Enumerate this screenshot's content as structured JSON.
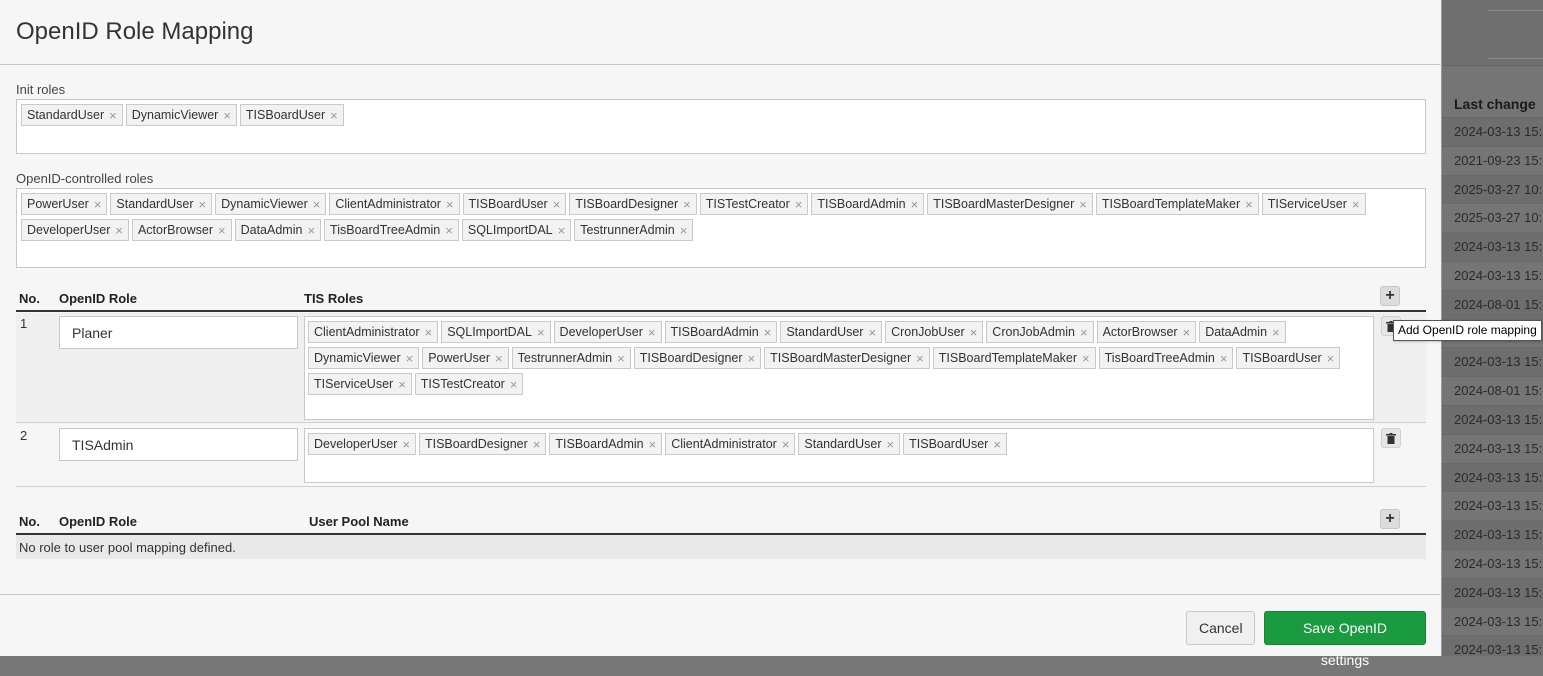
{
  "modal": {
    "title": "OpenID Role Mapping",
    "init_roles_label": "Init roles",
    "init_roles": [
      "StandardUser",
      "DynamicViewer",
      "TISBoardUser"
    ],
    "controlled_roles_label": "OpenID-controlled roles",
    "controlled_roles": [
      "PowerUser",
      "StandardUser",
      "DynamicViewer",
      "ClientAdministrator",
      "TISBoardUser",
      "TISBoardDesigner",
      "TISTestCreator",
      "TISBoardAdmin",
      "TISBoardMasterDesigner",
      "TISBoardTemplateMaker",
      "TIServiceUser",
      "DeveloperUser",
      "ActorBrowser",
      "DataAdmin",
      "TisBoardTreeAdmin",
      "SQLImportDAL",
      "TestrunnerAdmin"
    ],
    "role_table": {
      "col_no": "No.",
      "col_openid_role": "OpenID Role",
      "col_tis_roles": "TIS Roles",
      "rows": [
        {
          "no": "1",
          "openid_role": "Planer",
          "tis_roles": [
            "ClientAdministrator",
            "SQLImportDAL",
            "DeveloperUser",
            "TISBoardAdmin",
            "StandardUser",
            "CronJobUser",
            "CronJobAdmin",
            "ActorBrowser",
            "DataAdmin",
            "DynamicViewer",
            "PowerUser",
            "TestrunnerAdmin",
            "TISBoardDesigner",
            "TISBoardMasterDesigner",
            "TISBoardTemplateMaker",
            "TisBoardTreeAdmin",
            "TISBoardUser",
            "TIServiceUser",
            "TISTestCreator"
          ]
        },
        {
          "no": "2",
          "openid_role": "TISAdmin",
          "tis_roles": [
            "DeveloperUser",
            "TISBoardDesigner",
            "TISBoardAdmin",
            "ClientAdministrator",
            "StandardUser",
            "TISBoardUser"
          ]
        }
      ],
      "add_tooltip": "Add OpenID role mapping"
    },
    "pool_table": {
      "col_no": "No.",
      "col_openid_role": "OpenID Role",
      "col_user_pool": "User Pool Name",
      "empty_text": "No role to user pool mapping defined."
    },
    "footer": {
      "cancel_label": "Cancel",
      "save_label": "Save OpenID settings"
    }
  },
  "background": {
    "column_header": "Last change",
    "rows": [
      "2024-03-13 15:",
      "2021-09-23 15:",
      "2025-03-27 10:",
      "2025-03-27 10:",
      "2024-03-13 15:",
      "2024-03-13 15:",
      "2024-08-01 15:",
      "2024-03-13 15:",
      "2024-03-13 15:",
      "2024-08-01 15:",
      "2024-03-13 15:",
      "2024-03-13 15:",
      "2024-03-13 15:",
      "2024-03-13 15:",
      "2024-03-13 15:",
      "2024-03-13 15:",
      "2024-03-13 15:",
      "2024-03-13 15:",
      "2024-03-13 15:"
    ]
  },
  "colors": {
    "save_button": "#1a9b3f",
    "modal_bg": "#f6f6f6",
    "overlay": "#757575"
  }
}
